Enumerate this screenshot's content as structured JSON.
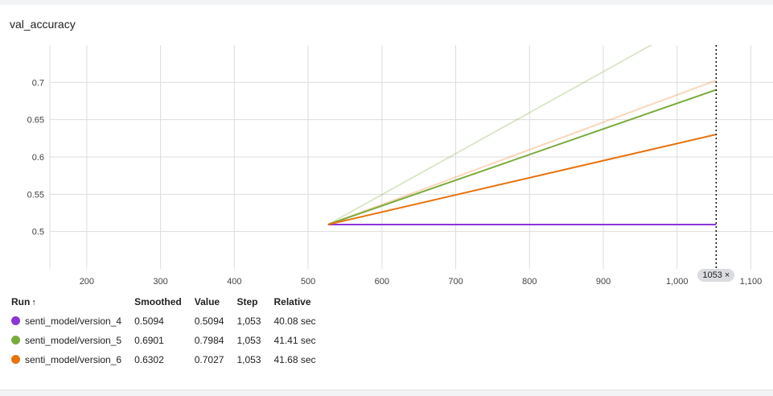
{
  "chart_data": {
    "type": "line",
    "title": "val_accuracy",
    "xlabel": "",
    "ylabel": "",
    "xlim": [
      150,
      1130
    ],
    "ylim": [
      0.45,
      0.75
    ],
    "x_ticks": [
      {
        "value": 200,
        "label": "200"
      },
      {
        "value": 300,
        "label": "300"
      },
      {
        "value": 400,
        "label": "400"
      },
      {
        "value": 500,
        "label": "500"
      },
      {
        "value": 600,
        "label": "600"
      },
      {
        "value": 700,
        "label": "700"
      },
      {
        "value": 800,
        "label": "800"
      },
      {
        "value": 900,
        "label": "900"
      },
      {
        "value": 1000,
        "label": "1,000"
      },
      {
        "value": 1100,
        "label": "1,100"
      }
    ],
    "y_ticks": [
      {
        "value": 0.5,
        "label": "0.5"
      },
      {
        "value": 0.55,
        "label": "0.55"
      },
      {
        "value": 0.6,
        "label": "0.6"
      },
      {
        "value": 0.65,
        "label": "0.65"
      },
      {
        "value": 0.7,
        "label": "0.7"
      }
    ],
    "grid": true,
    "hover_step": 1053,
    "series": [
      {
        "name": "senti_model/version_4",
        "color": "#8b36d6",
        "raw": {
          "x": [
            527,
            1053
          ],
          "y": [
            0.5094,
            0.5094
          ]
        },
        "smoothed": {
          "x": [
            527,
            1053
          ],
          "y": [
            0.5094,
            0.5094
          ]
        }
      },
      {
        "name": "senti_model/version_5",
        "color": "#79ab3c",
        "raw": {
          "x": [
            527,
            1053
          ],
          "y": [
            0.5094,
            0.7984
          ]
        },
        "smoothed": {
          "x": [
            527,
            1053
          ],
          "y": [
            0.5094,
            0.6901
          ]
        }
      },
      {
        "name": "senti_model/version_6",
        "color": "#e8710a",
        "raw": {
          "x": [
            527,
            1053
          ],
          "y": [
            0.5094,
            0.7027
          ]
        },
        "smoothed": {
          "x": [
            527,
            1053
          ],
          "y": [
            0.5094,
            0.6302
          ]
        }
      }
    ]
  },
  "hover": {
    "step_label": "1053",
    "close_glyph": "×",
    "close_icon": "close-icon"
  },
  "legend": {
    "headers": {
      "run": "Run",
      "sort_arrow": "↑",
      "smoothed": "Smoothed",
      "value": "Value",
      "step": "Step",
      "relative": "Relative"
    },
    "rows": [
      {
        "run": "senti_model/version_4",
        "color": "#8b36d6",
        "smoothed": "0.5094",
        "value": "0.5094",
        "step": "1,053",
        "relative": "40.08 sec"
      },
      {
        "run": "senti_model/version_5",
        "color": "#79ab3c",
        "smoothed": "0.6901",
        "value": "0.7984",
        "step": "1,053",
        "relative": "41.41 sec"
      },
      {
        "run": "senti_model/version_6",
        "color": "#e8710a",
        "smoothed": "0.6302",
        "value": "0.7027",
        "step": "1,053",
        "relative": "41.68 sec"
      }
    ]
  }
}
